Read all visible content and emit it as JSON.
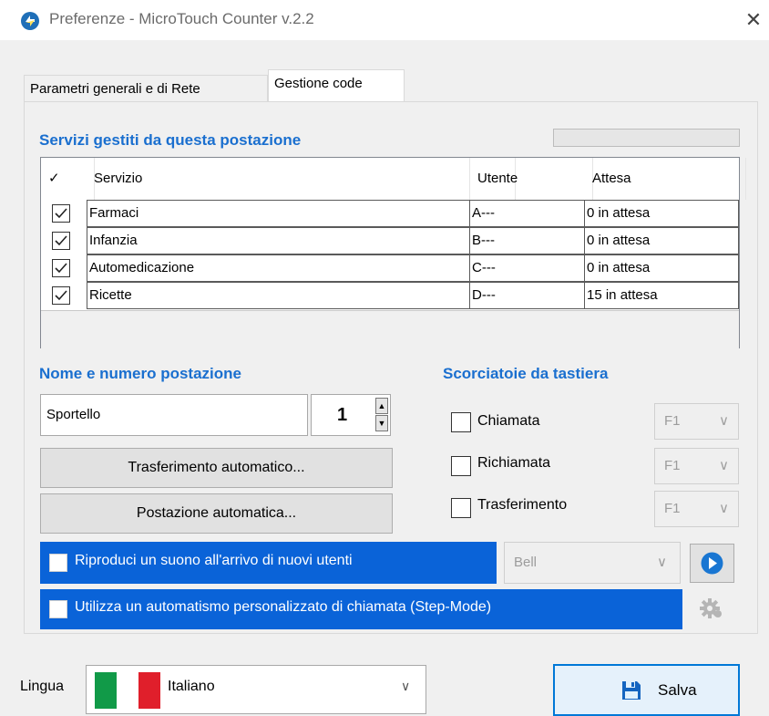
{
  "window": {
    "title": "Preferenze - MicroTouch Counter v.2.2",
    "close_glyph": "✕"
  },
  "tabs": [
    {
      "label": "Parametri generali e di Rete",
      "active": false
    },
    {
      "label": "Gestione code",
      "active": true
    }
  ],
  "services": {
    "title": "Servizi gestiti da questa postazione",
    "columns": {
      "check": "✓",
      "service": "Servizio",
      "user": "Utente",
      "wait": "Attesa"
    },
    "rows": [
      {
        "checked": true,
        "service": "Farmaci",
        "user": "A---",
        "wait": "0 in attesa"
      },
      {
        "checked": true,
        "service": "Infanzia",
        "user": "B---",
        "wait": "0 in attesa"
      },
      {
        "checked": true,
        "service": "Automedicazione",
        "user": "C---",
        "wait": "0 in attesa"
      },
      {
        "checked": true,
        "service": "Ricette",
        "user": "D---",
        "wait": "15 in attesa"
      }
    ]
  },
  "station": {
    "title": "Nome e numero postazione",
    "name": "Sportello",
    "number": "1",
    "spin_up": "▲",
    "spin_down": "▼",
    "transfer_button": "Trasferimento automatico...",
    "auto_station_button": "Postazione automatica..."
  },
  "shortcuts": {
    "title": "Scorciatoie da tastiera",
    "items": [
      {
        "label": "Chiamata",
        "checked": false,
        "key": "F1"
      },
      {
        "label": "Richiamata",
        "checked": false,
        "key": "F1"
      },
      {
        "label": "Trasferimento",
        "checked": false,
        "key": "F1"
      }
    ],
    "arrow": "∨"
  },
  "sound": {
    "label": "Riproduci un suono all'arrivo di nuovi utenti",
    "checked": false,
    "value": "Bell",
    "arrow": "∨",
    "play_icon": "play-icon"
  },
  "step_mode": {
    "label": "Utilizza un automatismo personalizzato di chiamata (Step-Mode)",
    "checked": false,
    "settings_icon": "gear-icon"
  },
  "language": {
    "label": "Lingua",
    "value": "Italiano",
    "arrow": "∨"
  },
  "save": {
    "label": "Salva",
    "icon": "floppy-disk-icon"
  },
  "colors": {
    "accent": "#0a63d8",
    "section_title": "#1a6fcf",
    "save_border": "#0078d7"
  }
}
